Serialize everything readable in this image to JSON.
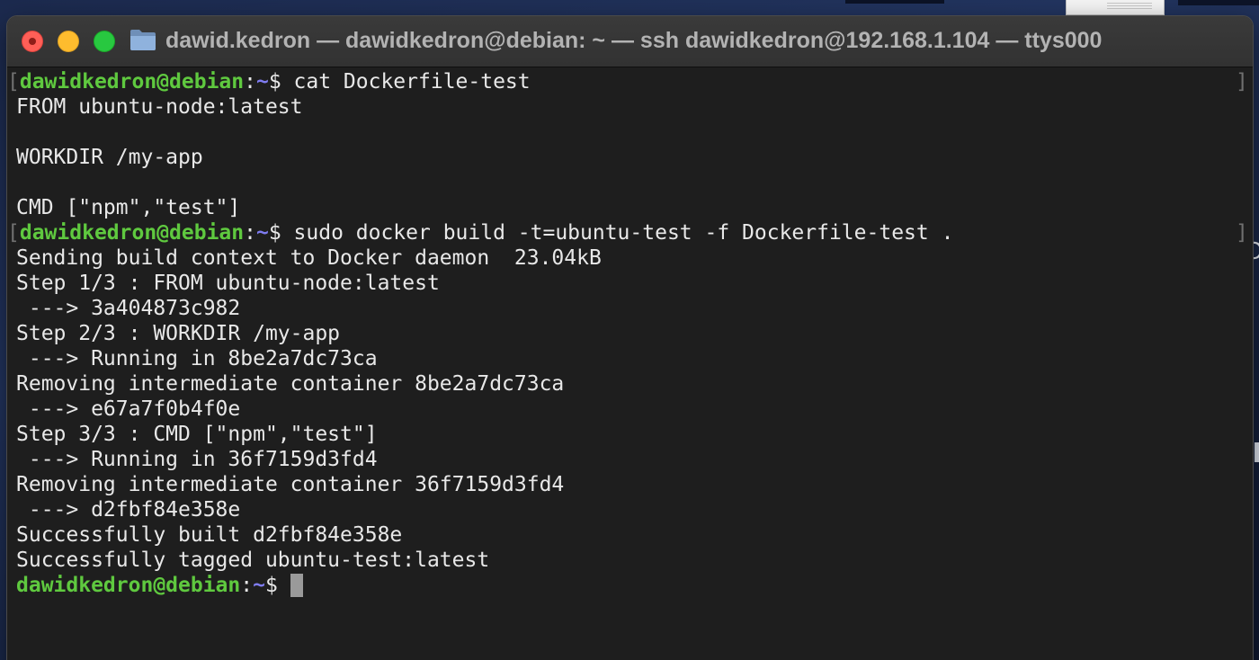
{
  "window": {
    "title": "dawid.kedron — dawidkedron@debian: ~ — ssh dawidkedron@192.168.1.104 — ttys000"
  },
  "desktop": {
    "edge_text": "O"
  },
  "prompt": {
    "user_host": "dawidkedron@debian",
    "sep": ":",
    "path": "~",
    "symbol": "$ "
  },
  "terminal": {
    "commands": [
      "cat Dockerfile-test",
      "sudo docker build -t=ubuntu-test -f Dockerfile-test ."
    ],
    "cat_output": [
      "FROM ubuntu-node:latest",
      "",
      "WORKDIR /my-app",
      "",
      "CMD [\"npm\",\"test\"]"
    ],
    "build_output": [
      "Sending build context to Docker daemon  23.04kB",
      "Step 1/3 : FROM ubuntu-node:latest",
      " ---> 3a404873c982",
      "Step 2/3 : WORKDIR /my-app",
      " ---> Running in 8be2a7dc73ca",
      "Removing intermediate container 8be2a7dc73ca",
      " ---> e67a7f0b4f0e",
      "Step 3/3 : CMD [\"npm\",\"test\"]",
      " ---> Running in 36f7159d3fd4",
      "Removing intermediate container 36f7159d3fd4",
      " ---> d2fbf84e358e",
      "Successfully built d2fbf84e358e",
      "Successfully tagged ubuntu-test:latest"
    ],
    "bracket_open": "[",
    "bracket_close": "]"
  },
  "colors": {
    "user_host": "#5fc93f",
    "path": "#7f7cf0",
    "text": "#e8e8e8",
    "background": "#1e1e1e"
  },
  "icons": {
    "close": "close-icon",
    "minimize": "minimize-icon",
    "zoom": "zoom-icon",
    "folder": "folder-icon",
    "cursor": "cursor-block"
  }
}
